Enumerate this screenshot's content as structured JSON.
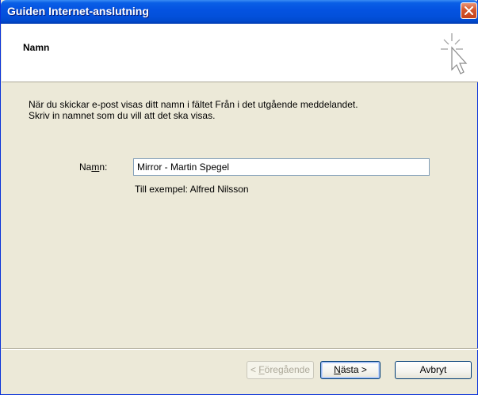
{
  "window": {
    "title": "Guiden Internet-anslutning"
  },
  "header": {
    "heading": "Namn",
    "icon": "wizard-cursor-icon"
  },
  "content": {
    "description_line1": "När du skickar e-post visas ditt namn i fältet Från i det utgående meddelandet.",
    "description_line2": "Skriv in namnet som du vill att det ska visas.",
    "name_label_pre": "Na",
    "name_label_accel": "m",
    "name_label_post": "n:",
    "name_value": "Mirror - Martin Spegel",
    "example_text": "Till exempel: Alfred Nilsson"
  },
  "buttons": {
    "prev_pre": "< ",
    "prev_accel": "F",
    "prev_post": "öregående",
    "next_accel": "N",
    "next_post": "ästa >",
    "cancel": "Avbryt"
  },
  "colors": {
    "title_bar": "#0453E1",
    "window_bg": "#ECE9D8",
    "close_button": "#C7431B"
  }
}
